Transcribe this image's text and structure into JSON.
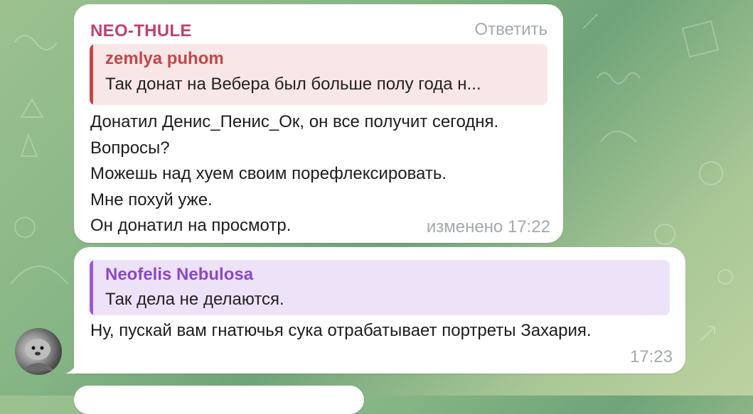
{
  "messages": [
    {
      "sender": "NEO-THULE",
      "reply_action": "Ответить",
      "quote": {
        "author": "zemlya puhom",
        "text": "Так донат на Вебера был больше полу года н..."
      },
      "lines": [
        "Донатил Денис_Пенис_Ок, он все получит сегодня.",
        "Вопросы?",
        "Можешь над хуем своим порефлексировать.",
        "Мне похуй уже.",
        "Он донатил на просмотр."
      ],
      "meta": "изменено 17:22"
    },
    {
      "quote": {
        "author": "Neofelis Nebulosa",
        "text": "Так дела не делаются."
      },
      "text": "Ну, пускай вам гнатючья сука отрабатывает портреты Захария.",
      "meta": "17:23"
    }
  ],
  "colors": {
    "sender_name": "#c33f71",
    "quote1_accent": "#c44649",
    "quote2_accent": "#8b47c9",
    "meta_text": "#a3a9ad"
  }
}
